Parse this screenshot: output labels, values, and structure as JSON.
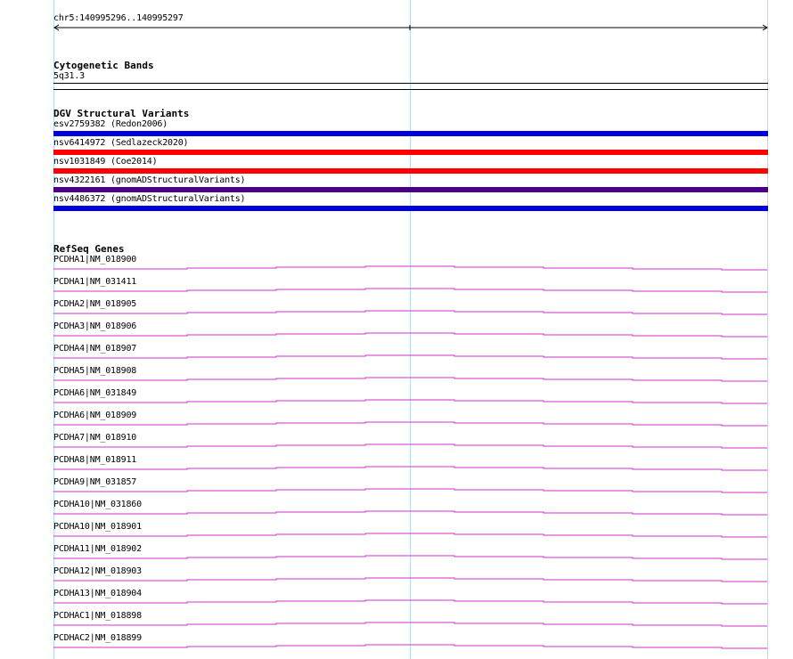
{
  "ruler": {
    "label": "chr5:140995296..140995297"
  },
  "cytoband": {
    "title": "Cytogenetic Bands",
    "band": "5q31.3"
  },
  "dgv": {
    "title": "DGV Structural Variants",
    "items": [
      {
        "label": "esv2759382 (Redon2006)",
        "color": "#0000dd"
      },
      {
        "label": "nsv6414972 (Sedlazeck2020)",
        "color": "#ff0000"
      },
      {
        "label": "nsv1031849 (Coe2014)",
        "color": "#ff0000"
      },
      {
        "label": "nsv4322161 (gnomADStructuralVariants)",
        "color": "#4b0082"
      },
      {
        "label": "nsv4486372 (gnomADStructuralVariants)",
        "color": "#0000dd"
      }
    ]
  },
  "refseq": {
    "title": "RefSeq Genes",
    "line_color": "#cc33cc",
    "genes": [
      "PCDHA1|NM_018900",
      "PCDHA1|NM_031411",
      "PCDHA2|NM_018905",
      "PCDHA3|NM_018906",
      "PCDHA4|NM_018907",
      "PCDHA5|NM_018908",
      "PCDHA6|NM_031849",
      "PCDHA6|NM_018909",
      "PCDHA7|NM_018910",
      "PCDHA8|NM_018911",
      "PCDHA9|NM_031857",
      "PCDHA10|NM_031860",
      "PCDHA10|NM_018901",
      "PCDHA11|NM_018902",
      "PCDHA12|NM_018903",
      "PCDHA13|NM_018904",
      "PCDHAC1|NM_018898",
      "PCDHAC2|NM_018899"
    ]
  }
}
